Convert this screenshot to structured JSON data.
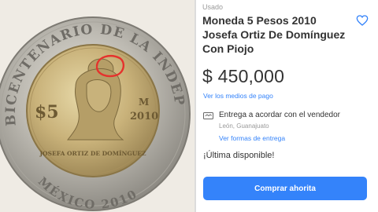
{
  "listing": {
    "condition": "Usado",
    "title": "Moneda 5 Pesos 2010 Josefa Ortiz De Domínguez Con Piojo",
    "price": "$ 450,000",
    "payment_link": "Ver los medios de pago"
  },
  "shipping": {
    "label": "Entrega a acordar con el vendedor",
    "location": "León, Guanajuato",
    "link": "Ver formas de entrega"
  },
  "stock": "¡Última disponible!",
  "buy_button": "Comprar ahorita",
  "coin": {
    "ring_text": "BICENTENARIO DE LA INDEPENDENCIA",
    "denomination": "$5",
    "mint_mark": "M",
    "year": "2010",
    "portrait_caption": "JOSEFA ORTIZ DE DOMÍNGUEZ",
    "bottom_text": "MÉXICO 2010"
  },
  "colors": {
    "accent": "#3483fa",
    "text": "#333333",
    "muted": "#9a9a9a",
    "annotation": "#e5322d"
  },
  "icons": {
    "favorite": "heart-outline-icon",
    "shipping": "handshake-icon"
  }
}
